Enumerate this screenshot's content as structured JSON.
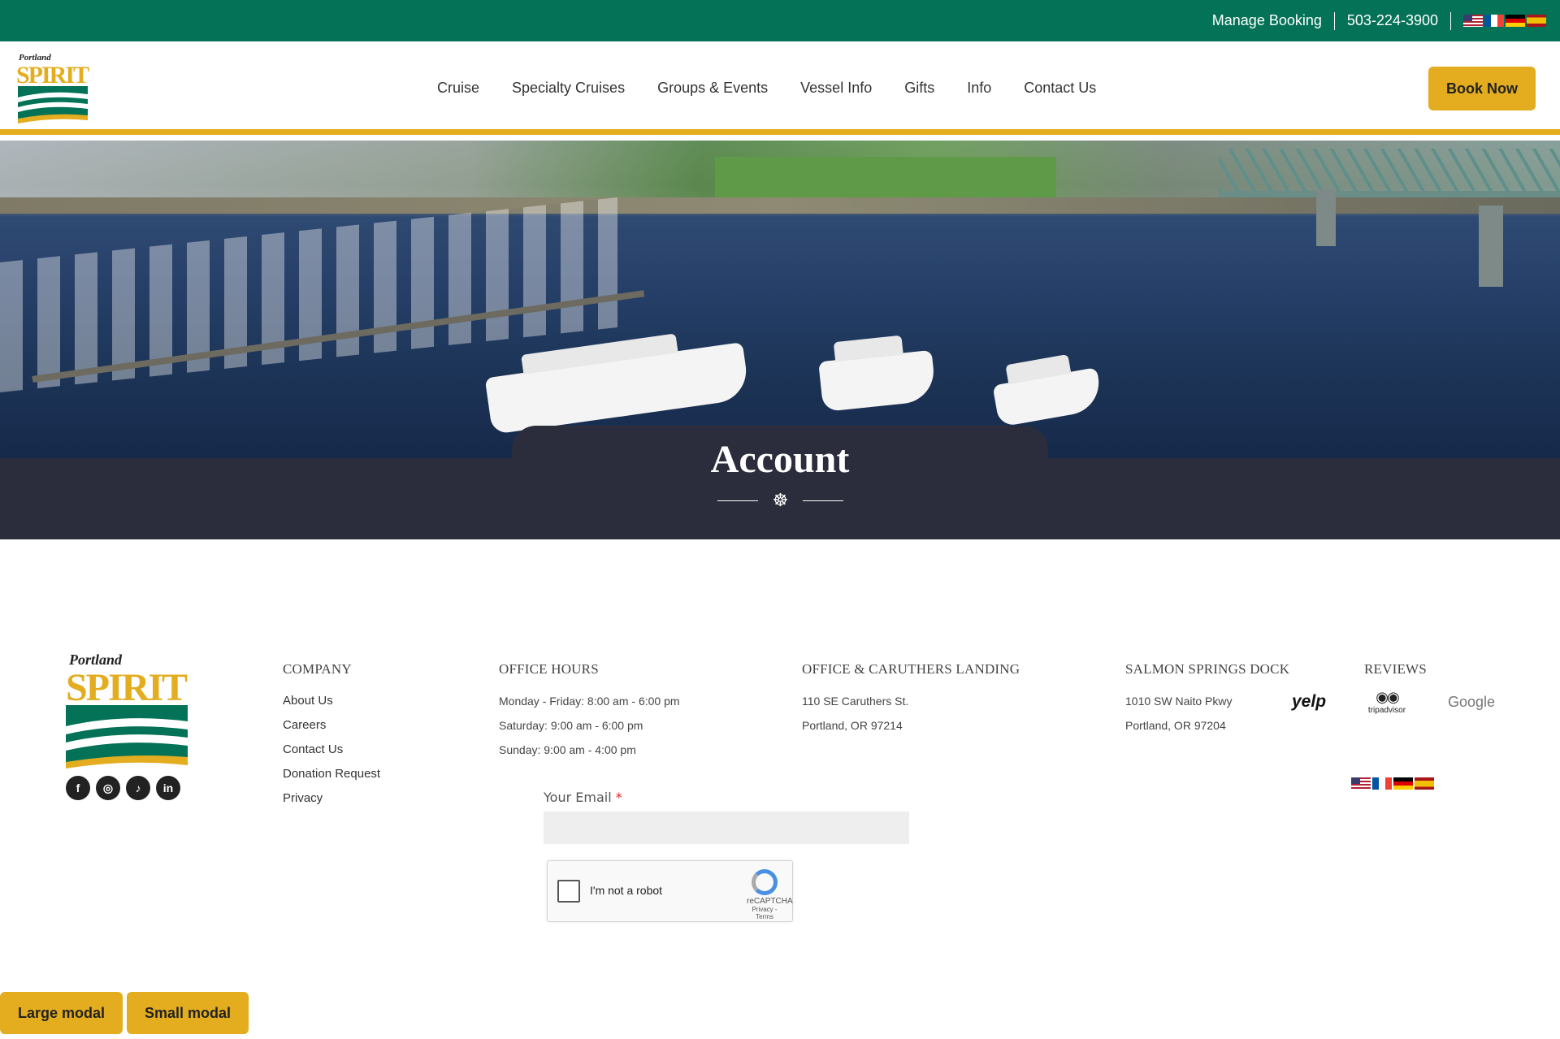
{
  "topbar": {
    "manage_booking": "Manage Booking",
    "phone": "503-224-3900",
    "languages": [
      "us-flag-icon",
      "fr-flag-icon",
      "de-flag-icon",
      "es-flag-icon"
    ]
  },
  "brand": {
    "logo_text_top": "Portland",
    "logo_text_main": "SPIRIT",
    "accent": "#e3ad1f",
    "green": "#047257",
    "dark": "#2b2d3c"
  },
  "nav": {
    "items": [
      "Cruise",
      "Specialty Cruises",
      "Groups & Events",
      "Vessel Info",
      "Gifts",
      "Info",
      "Contact Us"
    ],
    "book_now": "Book Now"
  },
  "page": {
    "title": "Account",
    "divider_icon": "ship-wheel-icon"
  },
  "footer": {
    "socials": [
      "facebook-icon",
      "instagram-icon",
      "tiktok-icon",
      "linkedin-icon"
    ],
    "company": {
      "heading": "COMPANY",
      "links": [
        "About Us",
        "Careers",
        "Contact Us",
        "Donation Request",
        "Privacy"
      ]
    },
    "hours": {
      "heading": "OFFICE HOURS",
      "lines": [
        "Monday - Friday: 8:00 am - 6:00 pm",
        "Saturday: 9:00 am - 6:00 pm",
        "Sunday: 9:00 am - 4:00 pm"
      ]
    },
    "office": {
      "heading": "OFFICE & CARUTHERS LANDING",
      "lines": [
        "110 SE Caruthers St.",
        "Portland, OR 97214"
      ]
    },
    "dock": {
      "heading": "SALMON SPRINGS DOCK",
      "lines": [
        "1010 SW Naito Pkwy",
        "Portland, OR 97204"
      ]
    },
    "reviews": {
      "heading": "REVIEWS",
      "yelp": "yelp",
      "tripadvisor": "tripadvisor",
      "google": "Google"
    }
  },
  "form": {
    "email_label": "Your Email",
    "required_mark": "*",
    "email_value": "",
    "recaptcha_text": "I'm not a robot",
    "recaptcha_brand": "reCAPTCHA",
    "recaptcha_terms": "Privacy - Terms"
  },
  "modals": {
    "large": "Large modal",
    "small": "Small modal"
  }
}
